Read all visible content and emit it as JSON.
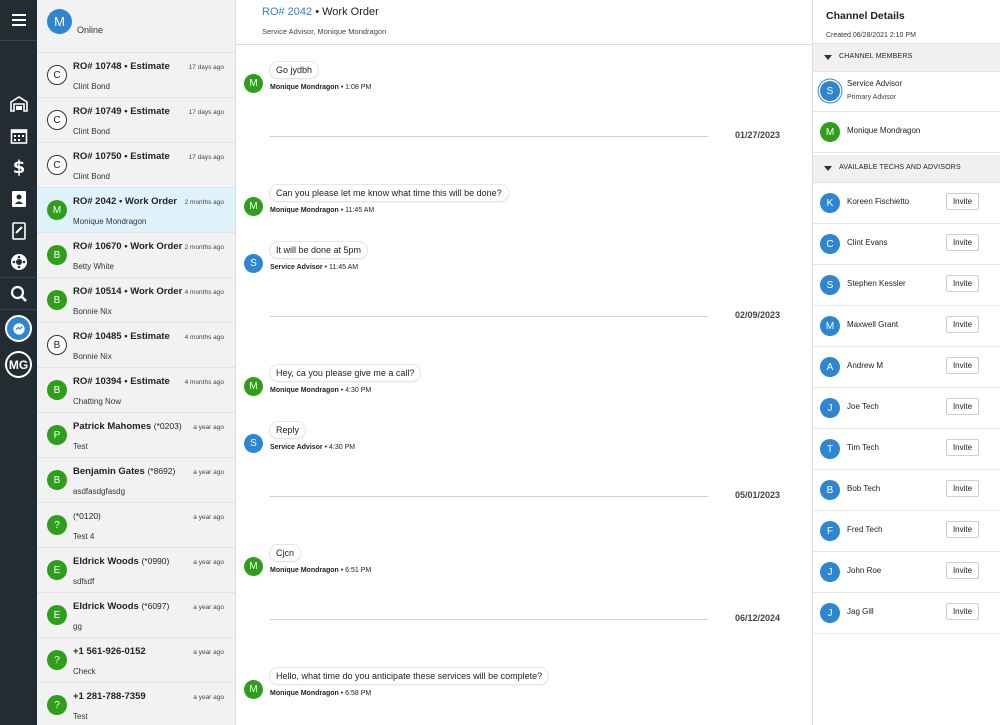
{
  "user": {
    "initial": "M",
    "status": "Online",
    "rail_initials": "MG"
  },
  "conversations": [
    {
      "avatar": "C",
      "style": "outline",
      "title": "RO# 10748 • Estimate",
      "ext": "",
      "subtitle": "Clint Bond",
      "time": "17 days ago"
    },
    {
      "avatar": "C",
      "style": "outline",
      "title": "RO# 10749 • Estimate",
      "ext": "",
      "subtitle": "Clint Bond",
      "time": "17 days ago"
    },
    {
      "avatar": "C",
      "style": "outline",
      "title": "RO# 10750 • Estimate",
      "ext": "",
      "subtitle": "Clint Bond",
      "time": "17 days ago"
    },
    {
      "avatar": "M",
      "style": "green",
      "title": "RO# 2042 • Work Order",
      "ext": "",
      "subtitle": "Monique Mondragon",
      "time": "2 months ago",
      "selected": true
    },
    {
      "avatar": "B",
      "style": "green",
      "title": "RO# 10670 • Work Order",
      "ext": "",
      "subtitle": "Betty White",
      "time": "2 months ago"
    },
    {
      "avatar": "B",
      "style": "green",
      "title": "RO# 10514 • Work Order",
      "ext": "",
      "subtitle": "Bonnie Nix",
      "time": "4 months ago"
    },
    {
      "avatar": "B",
      "style": "outline",
      "title": "RO# 10485 • Estimate",
      "ext": "",
      "subtitle": "Bonnie Nix",
      "time": "4 months ago"
    },
    {
      "avatar": "B",
      "style": "green",
      "title": "RO# 10394 • Estimate",
      "ext": "",
      "subtitle": "Chatting Now",
      "time": "4 months ago"
    },
    {
      "avatar": "P",
      "style": "green",
      "title": "Patrick Mahomes",
      "ext": "(*0203)",
      "subtitle": "Test",
      "time": "a year ago"
    },
    {
      "avatar": "B",
      "style": "green",
      "title": "Benjamin Gates",
      "ext": "(*8692)",
      "subtitle": "asdfasdgfasdg",
      "time": "a year ago"
    },
    {
      "avatar": "?",
      "style": "green",
      "title": "",
      "ext": "(*0120)",
      "subtitle": "Test 4",
      "time": "a year ago"
    },
    {
      "avatar": "E",
      "style": "green",
      "title": "Eldrick Woods",
      "ext": "(*0990)",
      "subtitle": "sdfsdf",
      "time": "a year ago"
    },
    {
      "avatar": "E",
      "style": "green",
      "title": "Eldrick Woods",
      "ext": "(*6097)",
      "subtitle": "gg",
      "time": "a year ago"
    },
    {
      "avatar": "?",
      "style": "green",
      "title": "+1 561-926-0152",
      "ext": "",
      "subtitle": "Check",
      "time": "a year ago"
    },
    {
      "avatar": "?",
      "style": "green",
      "title": "+1 281-788-7359",
      "ext": "",
      "subtitle": "Test",
      "time": "a year ago"
    }
  ],
  "chat": {
    "ro": "RO# 2042",
    "title_rest": " • Work Order",
    "subtitle": "Service Advisor, Monique Mondragon",
    "messages": [
      {
        "avatar": "M",
        "color": "green",
        "text": "Go jydbh",
        "sender": "Monique Mondragon",
        "time": " • 1:08 PM"
      },
      {
        "avatar": "M",
        "color": "green",
        "text": "Can you please let me know what time this will be done?",
        "sender": "Monique Mondragon",
        "time": " • 11:45 AM"
      },
      {
        "avatar": "S",
        "color": "blue",
        "text": "It will be done at 5pm",
        "sender": "Service Advisor",
        "time": " • 11:45 AM"
      },
      {
        "avatar": "M",
        "color": "green",
        "text": "Hey, ca you please give me a call?",
        "sender": "Monique Mondragon",
        "time": " • 4:30 PM"
      },
      {
        "avatar": "S",
        "color": "blue",
        "text": "Reply",
        "sender": "Service Advisor",
        "time": " • 4:30 PM"
      },
      {
        "avatar": "M",
        "color": "green",
        "text": "Cjcn",
        "sender": "Monique Mondragon",
        "time": " • 6:51 PM"
      },
      {
        "avatar": "M",
        "color": "green",
        "text": "Hello, what time do you anticipate these services will be complete?",
        "sender": "Monique Mondragon",
        "time": " • 6:58 PM"
      }
    ],
    "dates": [
      "01/27/2023",
      "02/09/2023",
      "05/01/2023",
      "06/12/2024"
    ]
  },
  "details": {
    "title": "Channel Details",
    "created": "Created 06/28/2021 2:10 PM",
    "members_header": "CHANNEL MEMBERS",
    "members": [
      {
        "avatar": "S",
        "color": "#2e86d1",
        "name": "Service Advisor",
        "role": "Primary Advisor"
      },
      {
        "avatar": "M",
        "color": "#2f9e1a",
        "name": "Monique Mondragon",
        "role": ""
      }
    ],
    "techs_header": "AVAILABLE TECHS AND ADVISORS",
    "invite_label": "Invite",
    "techs": [
      {
        "avatar": "K",
        "name": "Koreen Fischietto"
      },
      {
        "avatar": "C",
        "name": "Clint Evans"
      },
      {
        "avatar": "S",
        "name": "Stephen Kessler"
      },
      {
        "avatar": "M",
        "name": "Maxwell Grant"
      },
      {
        "avatar": "A",
        "name": "Andrew M"
      },
      {
        "avatar": "J",
        "name": "Joe Tech"
      },
      {
        "avatar": "T",
        "name": "Tim Tech"
      },
      {
        "avatar": "B",
        "name": "Bob Tech"
      },
      {
        "avatar": "F",
        "name": "Fred Tech"
      },
      {
        "avatar": "J",
        "name": "John Roe"
      },
      {
        "avatar": "J",
        "name": "Jag Gill"
      }
    ]
  },
  "rail": {
    "icons": [
      "menu-icon",
      "garage-icon",
      "calendar-icon",
      "dollar-icon",
      "contacts-icon",
      "inspection-icon",
      "tire-icon",
      "search-icon",
      "chat-icon"
    ]
  },
  "colors": {
    "accent": "#2e86d1",
    "green": "#2f9e1a",
    "rail": "#232b33",
    "selected": "#e0f3fc"
  }
}
